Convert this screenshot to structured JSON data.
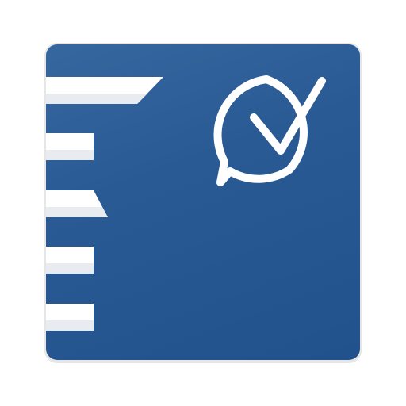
{
  "app_icon": {
    "name": "checklist-app-icon",
    "background_color": "#2b5b95",
    "glyph_color": "#ffffff",
    "stripe_shadow_color": "#e9ecef",
    "icons": [
      "list-stripes-icon",
      "chat-bubble-check-icon"
    ]
  }
}
